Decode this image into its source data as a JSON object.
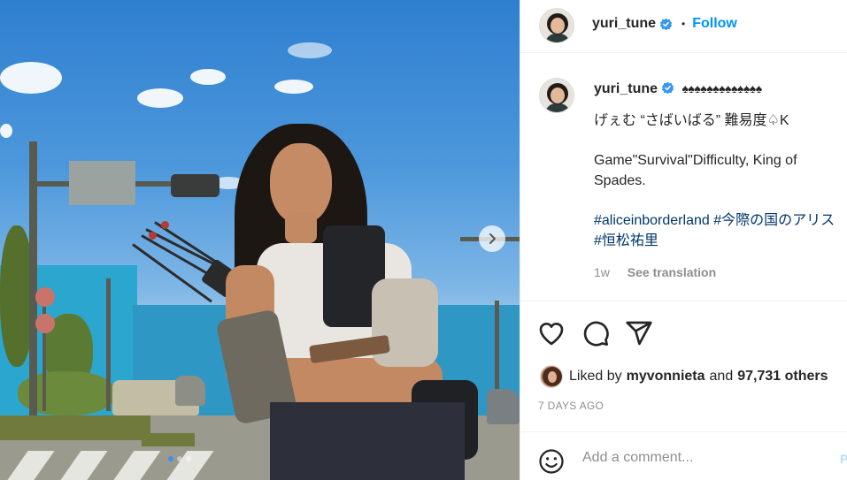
{
  "post": {
    "username": "yuri_tune",
    "follow_label": "Follow",
    "separator": "•",
    "caption": {
      "suits": "♠♠♠♠♠♠♠♠♠♠♠♠♠",
      "line_jp": "げぇむ “さばいばる” 難易度♤K",
      "line_en": "Game\"Survival\"Difficulty, King of Spades.",
      "tag1": "#aliceinborderland",
      "tag2": "#今際の国のアリス",
      "tag3": "#恒松祐里"
    },
    "age": "1w",
    "see_translation": "See translation",
    "likes": {
      "prefix": "Liked by",
      "user": "myvonnieta",
      "joiner": "and",
      "others": "97,731 others"
    },
    "date": "7 DAYS AGO",
    "comment_placeholder": "Add a comment...",
    "post_label": "P"
  },
  "colors": {
    "accent": "#0095f6",
    "hashtag": "#00376b",
    "muted": "#8e8e8e"
  },
  "icons": [
    "verified-badge-icon",
    "heart-icon",
    "comment-icon",
    "share-icon",
    "emoji-icon",
    "chevron-right-icon"
  ]
}
